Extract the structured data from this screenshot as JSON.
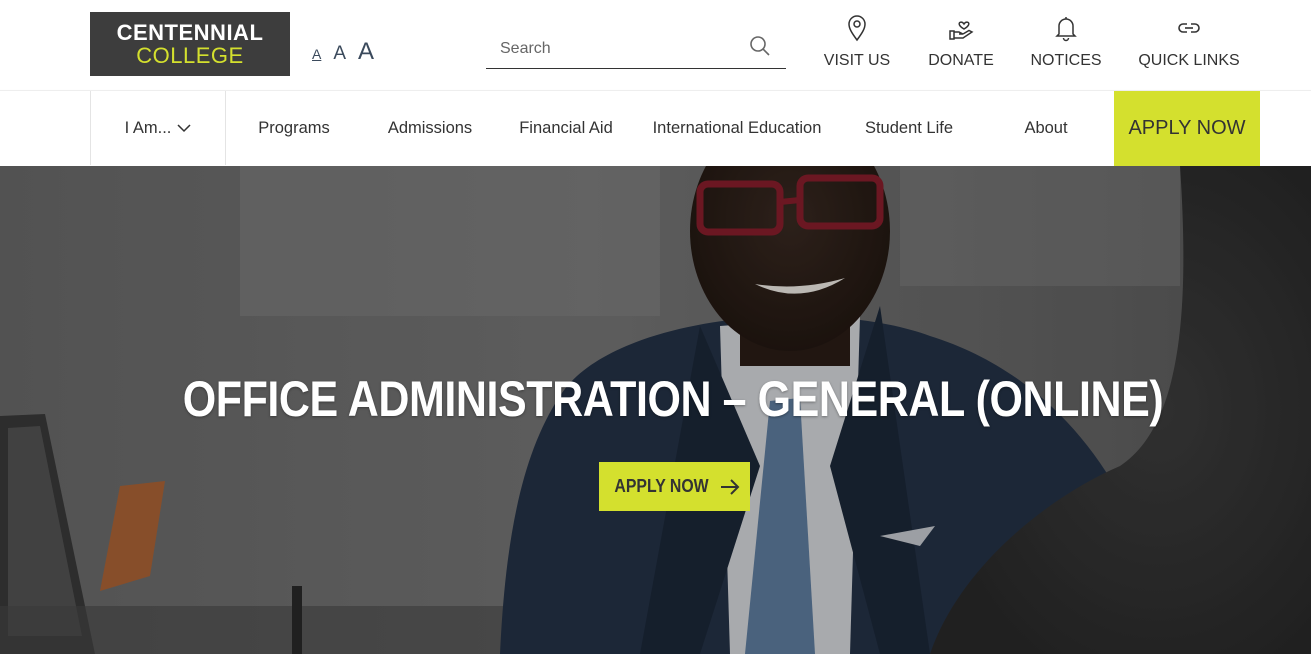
{
  "logo": {
    "line1": "CENTENNIAL",
    "line2": "COLLEGE"
  },
  "text_size": {
    "small": "A",
    "medium": "A",
    "large": "A"
  },
  "search": {
    "placeholder": "Search",
    "value": ""
  },
  "utility_links": {
    "visit": {
      "label": "VISIT US",
      "icon": "map-pin-icon"
    },
    "donate": {
      "label": "DONATE",
      "icon": "heart-hand-icon"
    },
    "notices": {
      "label": "NOTICES",
      "icon": "bell-icon"
    },
    "quick": {
      "label": "QUICK LINKS",
      "icon": "link-icon"
    }
  },
  "nav": {
    "i_am": "I Am...",
    "programs": "Programs",
    "admissions": "Admissions",
    "financial_aid": "Financial Aid",
    "international": "International Education",
    "student_life": "Student Life",
    "about": "About",
    "apply": "APPLY NOW"
  },
  "hero": {
    "title": "OFFICE ADMINISTRATION – GENERAL (ONLINE)",
    "apply_label": "APPLY NOW"
  },
  "colors": {
    "accent": "#d4e02e",
    "logo_bg": "#3d3d3d",
    "text": "#333333"
  }
}
